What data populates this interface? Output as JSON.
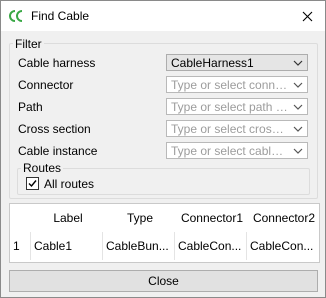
{
  "window": {
    "title": "Find Cable",
    "close_glyph": "✕",
    "icon": "cable-app-icon"
  },
  "filter": {
    "title": "Filter",
    "fields": [
      {
        "label": "Cable harness",
        "value": "CableHarness1",
        "placeholder": ""
      },
      {
        "label": "Connector",
        "value": "",
        "placeholder": "Type or select conne..."
      },
      {
        "label": "Path",
        "value": "",
        "placeholder": "Type or select path t..."
      },
      {
        "label": "Cross section",
        "value": "",
        "placeholder": "Type or select cross ..."
      },
      {
        "label": "Cable instance",
        "value": "",
        "placeholder": "Type or select cable ..."
      }
    ],
    "routes": {
      "title": "Routes",
      "all_routes_label": "All routes",
      "all_routes_checked": true
    }
  },
  "table": {
    "headers": [
      "Label",
      "Type",
      "Connector1",
      "Connector2"
    ],
    "rows": [
      {
        "index": "1",
        "cells": [
          "Cable1",
          "CableBun...",
          "CableCon...",
          "CableCon..."
        ]
      }
    ]
  },
  "footer": {
    "close_label": "Close"
  },
  "colors": {
    "title_bar": "#ffffff",
    "dialog_bg": "#f0f0f0",
    "icon_green": "#3aa846"
  }
}
